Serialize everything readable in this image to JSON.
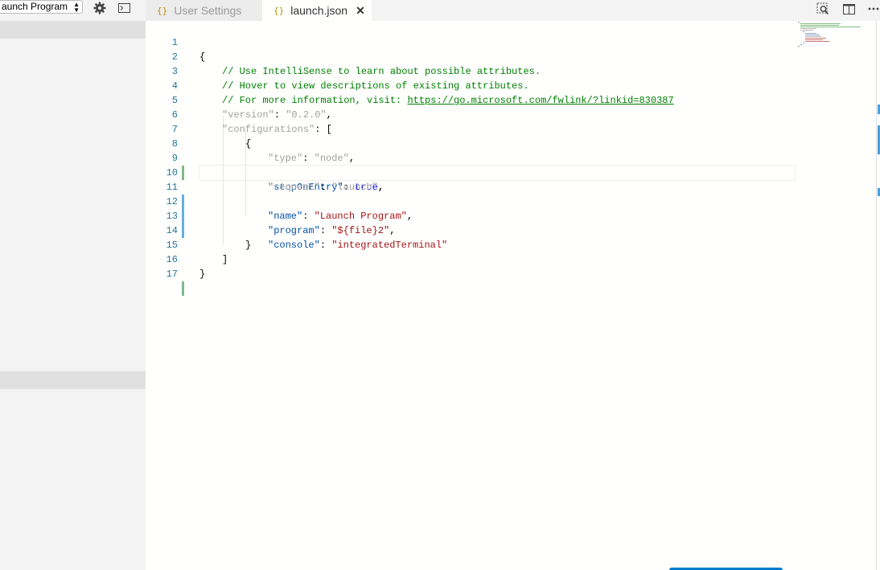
{
  "debug_toolbar": {
    "config_selected": "aunch Program",
    "settings_icon": "gear-icon",
    "console_icon": "terminal-icon"
  },
  "tabs": [
    {
      "label": "User Settings",
      "icon": "json-braces-icon",
      "active": false
    },
    {
      "label": "launch.json",
      "icon": "json-braces-icon",
      "active": true,
      "close": "✕"
    }
  ],
  "tab_icon_text": "{}",
  "editor_actions": {
    "find_icon": "search-icon",
    "split_icon": "split-editor-icon",
    "more_icon": "more-icon"
  },
  "editor": {
    "line_numbers": [
      "1",
      "2",
      "3",
      "4",
      "5",
      "6",
      "7",
      "8",
      "9",
      "10",
      "11",
      "12",
      "13",
      "14",
      "15",
      "16",
      "17"
    ],
    "line_texts": {
      "l1": "{",
      "l2": "// Use IntelliSense to learn about possible attributes.",
      "l3": "// Hover to view descriptions of existing attributes.",
      "l4a": "// For more information, visit: ",
      "l4b": "https://go.microsoft.com/fwlink/?linkid=830387",
      "l5a": "\"version\"",
      "l5b": ": ",
      "l5c": "\"0.2.0\"",
      "l5d": ",",
      "l6a": "\"configurations\"",
      "l6b": ": [",
      "l7": "{",
      "l8a": "\"type\"",
      "l8b": ": ",
      "l8c": "\"node\"",
      "l8d": ",",
      "l9a": "\"stopOnEntry\"",
      "l9b": ": ",
      "l9c": "true",
      "l9d": ",",
      "l10a": "\"request\"",
      "l10b": ": ",
      "l10c": "\"launch\"",
      "l10d": ",",
      "l11a": "\"name\"",
      "l11b": ": ",
      "l11c": "\"Launch Program\"",
      "l11d": ",",
      "l12a": "\"program\"",
      "l12b": ": ",
      "l12c": "\"${file}2\"",
      "l12d": ",",
      "l13a": "\"console\"",
      "l13b": ": ",
      "l13c": "\"integratedTerminal\"",
      "l14": "}",
      "l15": "]",
      "l16": "}"
    }
  },
  "colors": {
    "added_mark": "#81b88b",
    "modified_mark": "#66afe0",
    "accent": "#007acc"
  }
}
